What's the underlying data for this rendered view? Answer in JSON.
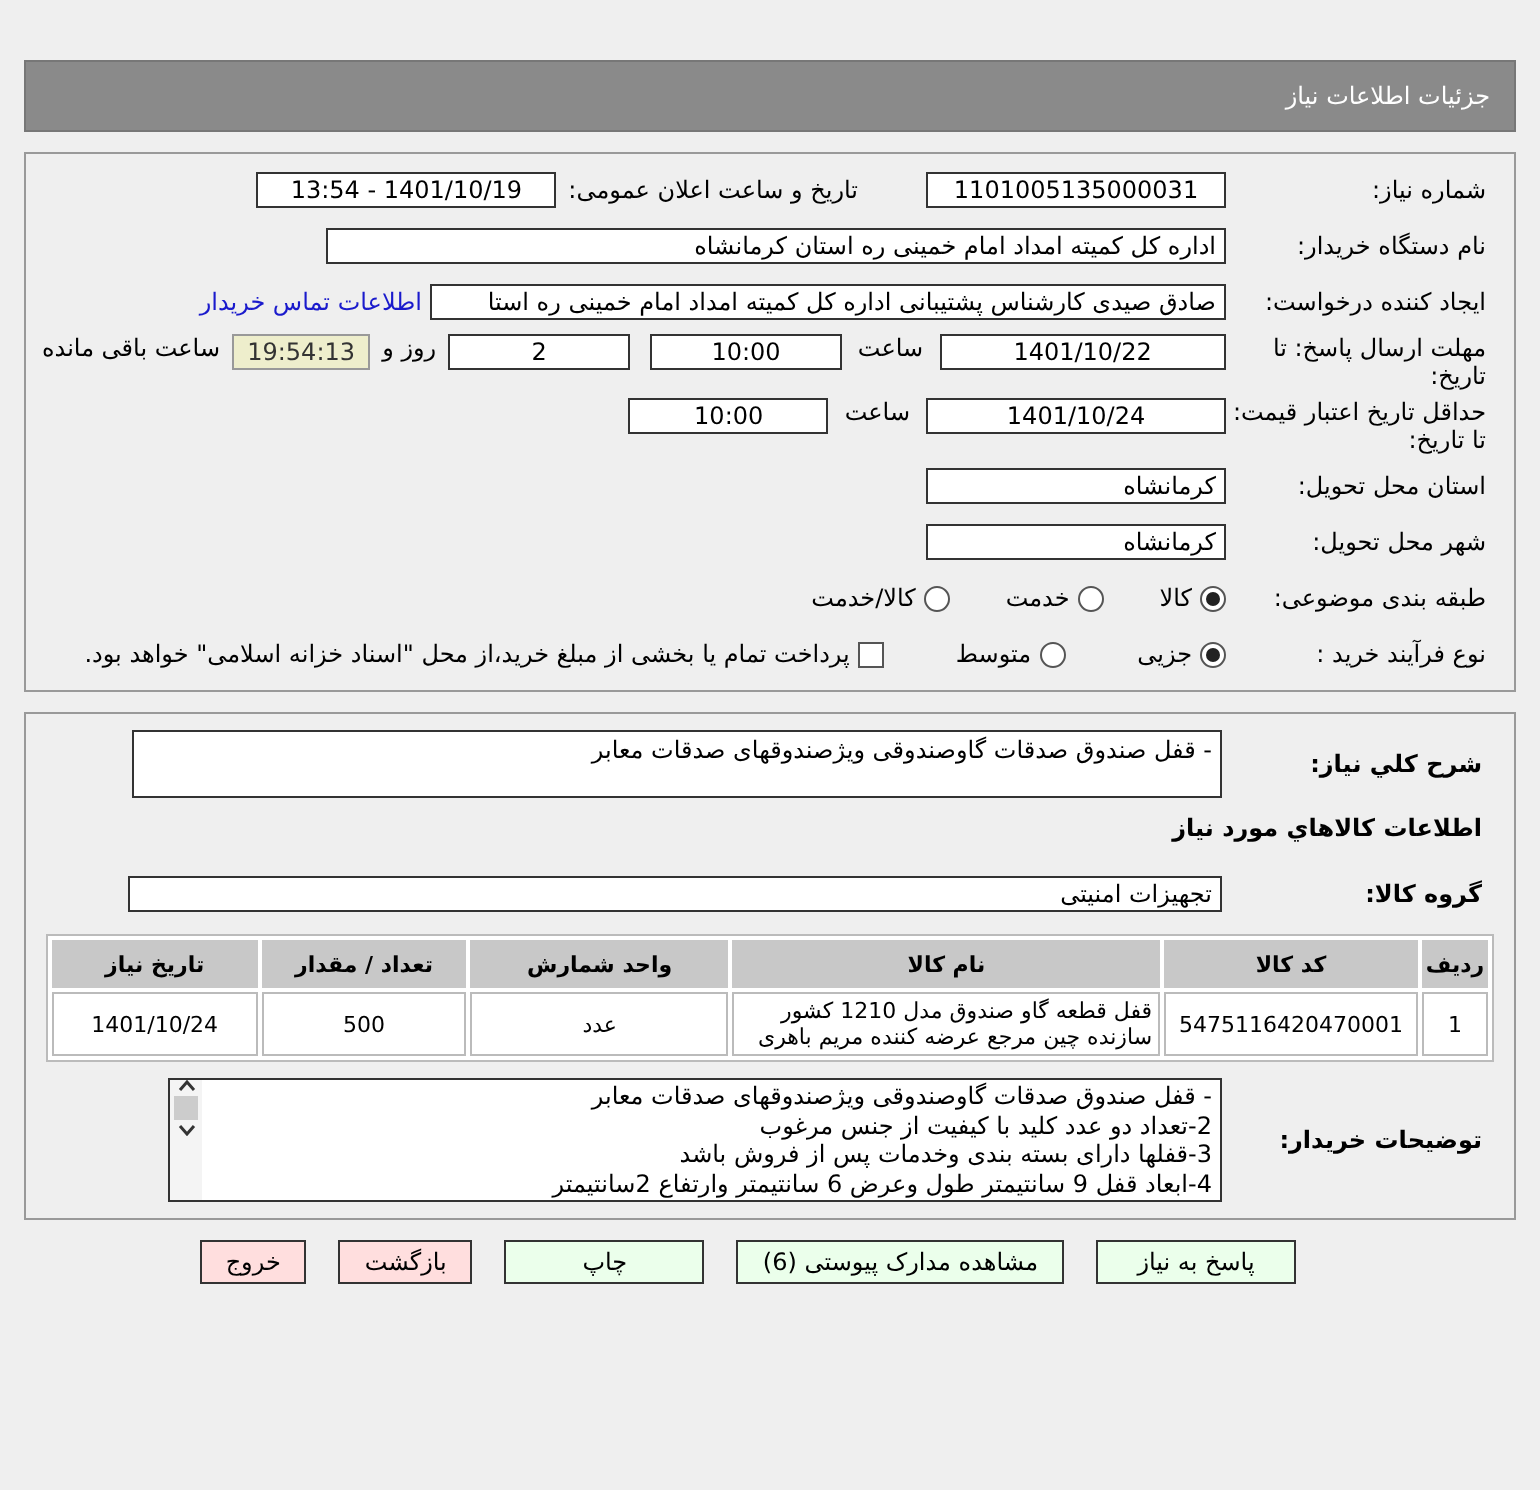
{
  "header": {
    "title": "جزئیات اطلاعات نیاز"
  },
  "details": {
    "need_number": {
      "label": "شماره نیاز:",
      "value": "1101005135000031"
    },
    "announce": {
      "label": "تاریخ و ساعت اعلان عمومی:",
      "value": "1401/10/19 - 13:54"
    },
    "buyer": {
      "label": "نام دستگاه خریدار:",
      "value": "اداره کل کمیته امداد امام خمینی  ره  استان کرمانشاه"
    },
    "creator": {
      "label": "ایجاد کننده درخواست:",
      "value": "صادق  صیدی  کارشناس پشتیبانی  اداره کل کمیته امداد امام خمینی  ره  استا",
      "link": "اطلاعات تماس خریدار"
    },
    "deadline": {
      "label": "مهلت ارسال پاسخ: تا تاریخ:",
      "date": "1401/10/22",
      "time_label": "ساعت",
      "time": "10:00",
      "days": "2",
      "days_label": "روز و",
      "remaining": "19:54:13",
      "remaining_label": "ساعت باقی مانده"
    },
    "validity": {
      "label": "حداقل تاریخ اعتبار قیمت: تا تاریخ:",
      "date": "1401/10/24",
      "time_label": "ساعت",
      "time": "10:00"
    },
    "province": {
      "label": "استان محل تحویل:",
      "value": "کرمانشاه"
    },
    "city": {
      "label": "شهر محل تحویل:",
      "value": "کرمانشاه"
    },
    "category": {
      "label": "طبقه بندی موضوعی:",
      "options": [
        {
          "label": "کالا",
          "selected": true
        },
        {
          "label": "خدمت",
          "selected": false
        },
        {
          "label": "کالا/خدمت",
          "selected": false
        }
      ]
    },
    "process": {
      "label": "نوع فرآیند خرید :",
      "options": [
        {
          "label": "جزیی",
          "selected": true
        },
        {
          "label": "متوسط",
          "selected": false
        }
      ],
      "payment": {
        "label": "پرداخت تمام یا بخشی از مبلغ خرید،از محل \"اسناد خزانه اسلامی\" خواهد بود.",
        "checked": false
      }
    }
  },
  "summary": {
    "label": "شرح کلي نياز:",
    "value": "- قفل صندوق صدقات گاوصندوقی ویژصندوقهای صدقات معابر"
  },
  "goods_title": "اطلاعات كالاهاي مورد نياز",
  "group": {
    "label": "گروه کالا:",
    "value": "تجهیزات امنیتی"
  },
  "table": {
    "columns": [
      "ردیف",
      "کد کالا",
      "نام کالا",
      "واحد شمارش",
      "تعداد / مقدار",
      "تاریخ نیاز"
    ],
    "rows": [
      [
        "1",
        "5475116420470001",
        "قفل قطعه گاو صندوق مدل 1210 کشور سازنده چین مرجع عرضه کننده مریم باهری",
        "عدد",
        "500",
        "1401/10/24"
      ]
    ]
  },
  "notes": {
    "label": "توضیحات خریدار:",
    "lines": [
      "- قفل صندوق صدقات گاوصندوقی ویژصندوقهای صدقات معابر",
      "2-تعداد دو عدد کلید با کیفیت از جنس مرغوب",
      "3-قفلها دارای بسته بندی وخدمات پس از فروش باشد",
      "4-ابعاد قفل 9 سانتیمتر طول وعرض 6 سانتیمتر وارتفاع 2سانتیمتر"
    ]
  },
  "buttons": [
    {
      "label": "پاسخ به نیاز",
      "kind": "action"
    },
    {
      "label": "مشاهده مدارک پیوستی (6)",
      "kind": "action"
    },
    {
      "label": "چاپ",
      "kind": "action"
    },
    {
      "label": "بازگشت",
      "kind": "exit"
    },
    {
      "label": "خروج",
      "kind": "exit"
    }
  ]
}
